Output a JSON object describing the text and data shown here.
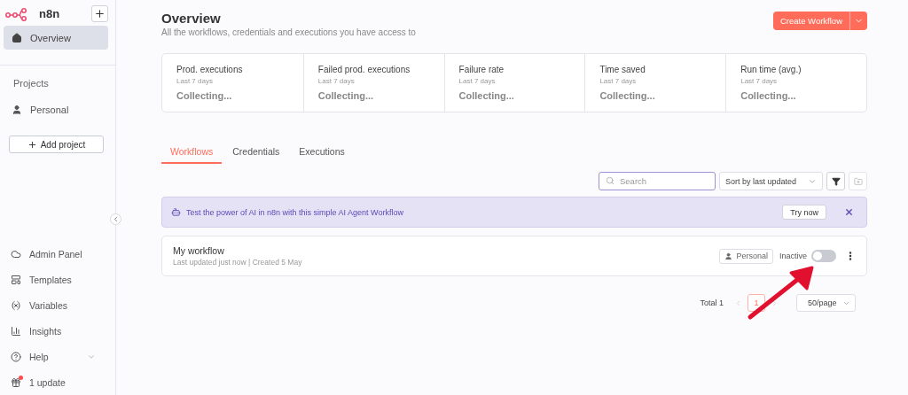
{
  "sidebar": {
    "logo": "n8n",
    "nav": [
      {
        "label": "Overview",
        "selected": true
      }
    ],
    "projects_heading": "Projects",
    "projects": [
      {
        "label": "Personal",
        "selected": false
      }
    ],
    "add_project": "Add project",
    "bottom_items": [
      {
        "label": "Admin Panel"
      },
      {
        "label": "Templates"
      },
      {
        "label": "Variables"
      },
      {
        "label": "Insights"
      },
      {
        "label": "Help",
        "expanded": false
      },
      {
        "label": "1 update"
      }
    ]
  },
  "header": {
    "title": "Overview",
    "subtitle": "All the workflows, credentials and executions you have access to",
    "create_button": "Create Workflow"
  },
  "stats": [
    {
      "title": "Prod. executions",
      "period": "Last 7 days",
      "value": "Collecting..."
    },
    {
      "title": "Failed prod. executions",
      "period": "Last 7 days",
      "value": "Collecting..."
    },
    {
      "title": "Failure rate",
      "period": "Last 7 days",
      "value": "Collecting..."
    },
    {
      "title": "Time saved",
      "period": "Last 7 days",
      "value": "Collecting..."
    },
    {
      "title": "Run time (avg.)",
      "period": "Last 7 days",
      "value": "Collecting..."
    }
  ],
  "tabs": [
    {
      "label": "Workflows",
      "selected": true
    },
    {
      "label": "Credentials",
      "selected": false
    },
    {
      "label": "Executions",
      "selected": false
    }
  ],
  "toolbar": {
    "search": {
      "placeholder": "Search"
    },
    "sort": "Sort by last updated"
  },
  "banner": {
    "text": "Test the power of AI in n8n with this simple AI Agent Workflow",
    "button": "Try now"
  },
  "workflows": [
    {
      "name": "My workflow",
      "meta": "Last updated just now | Created 5 May",
      "project": "Personal",
      "status": "Inactive",
      "on": false
    }
  ],
  "pagination": {
    "total": "Total 1",
    "pages": [
      {
        "label": "1",
        "selected": true
      }
    ],
    "page_size": "50/page"
  }
}
